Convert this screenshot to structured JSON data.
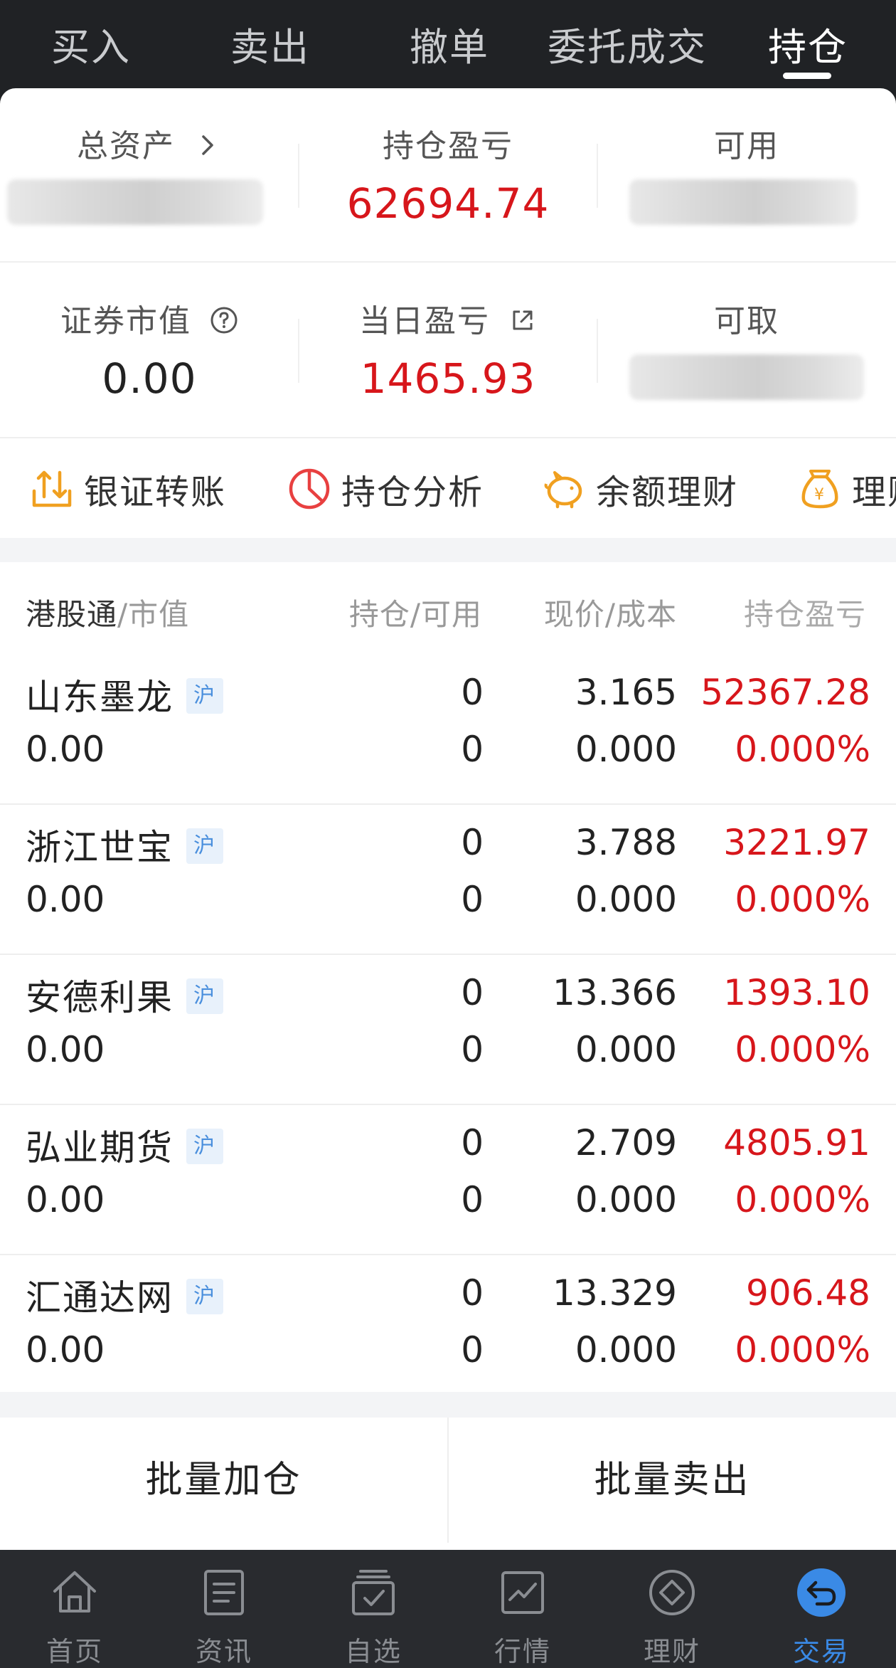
{
  "top_tabs": [
    {
      "label": "买入"
    },
    {
      "label": "卖出"
    },
    {
      "label": "撤单"
    },
    {
      "label": "委托成交"
    },
    {
      "label": "持仓",
      "active": true
    }
  ],
  "summary": {
    "total_assets_label": "总资产",
    "position_pl_label": "持仓盈亏",
    "position_pl_value": "62694.74",
    "available_label": "可用",
    "market_value_label": "证券市值",
    "market_value_value": "0.00",
    "daily_pl_label": "当日盈亏",
    "daily_pl_value": "1465.93",
    "withdrawable_label": "可取"
  },
  "quick_actions": [
    {
      "label": "银证转账",
      "icon": "transfer-icon"
    },
    {
      "label": "持仓分析",
      "icon": "pie-chart-icon"
    },
    {
      "label": "余额理财",
      "icon": "piggy-bank-icon"
    },
    {
      "label": "理财",
      "icon": "money-bag-icon"
    }
  ],
  "table": {
    "headers": {
      "name_part1": "港股通",
      "name_part2": "/市值",
      "position": "持仓/可用",
      "price": "现价/成本",
      "pl": "持仓盈亏"
    },
    "rows": [
      {
        "name": "山东墨龙",
        "tag": "沪",
        "market_value": "0.00",
        "position": "0",
        "available": "0",
        "price": "3.165",
        "cost": "0.000",
        "pl": "52367.28",
        "pl_pct": "0.000%"
      },
      {
        "name": "浙江世宝",
        "tag": "沪",
        "market_value": "0.00",
        "position": "0",
        "available": "0",
        "price": "3.788",
        "cost": "0.000",
        "pl": "3221.97",
        "pl_pct": "0.000%"
      },
      {
        "name": "安德利果",
        "tag": "沪",
        "market_value": "0.00",
        "position": "0",
        "available": "0",
        "price": "13.366",
        "cost": "0.000",
        "pl": "1393.10",
        "pl_pct": "0.000%"
      },
      {
        "name": "弘业期货",
        "tag": "沪",
        "market_value": "0.00",
        "position": "0",
        "available": "0",
        "price": "2.709",
        "cost": "0.000",
        "pl": "4805.91",
        "pl_pct": "0.000%"
      },
      {
        "name": "汇通达网",
        "tag": "沪",
        "market_value": "0.00",
        "position": "0",
        "available": "0",
        "price": "13.329",
        "cost": "0.000",
        "pl": "906.48",
        "pl_pct": "0.000%"
      }
    ]
  },
  "batch": {
    "add_label": "批量加仓",
    "sell_label": "批量卖出"
  },
  "bottom_nav": [
    {
      "label": "首页",
      "icon": "home-icon"
    },
    {
      "label": "资讯",
      "icon": "news-icon"
    },
    {
      "label": "自选",
      "icon": "watchlist-icon"
    },
    {
      "label": "行情",
      "icon": "market-chart-icon"
    },
    {
      "label": "理财",
      "icon": "wealth-icon"
    },
    {
      "label": "交易",
      "icon": "trade-icon",
      "active": true
    }
  ],
  "colors": {
    "up_red": "#d7161b",
    "active_blue": "#3a8ae6",
    "quick_orange": "#f0a020",
    "quick_red": "#e84040"
  }
}
